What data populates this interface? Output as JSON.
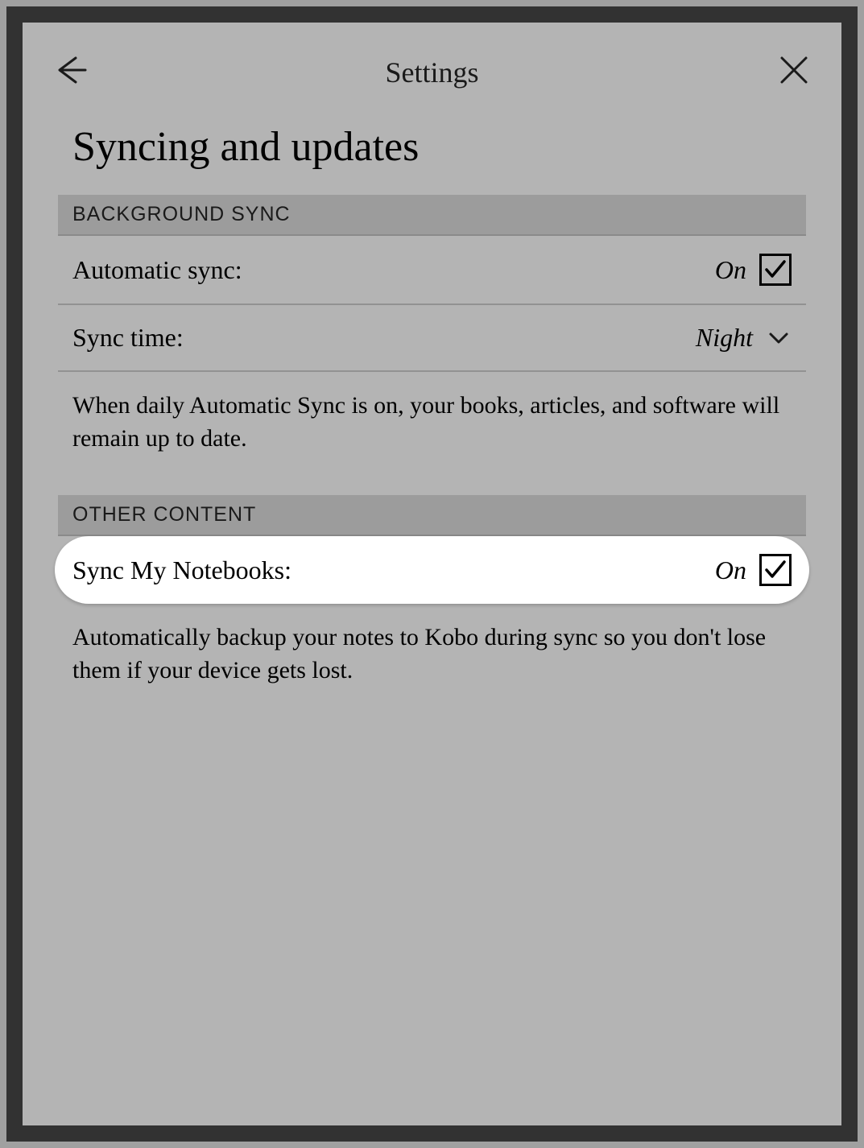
{
  "header": {
    "title": "Settings"
  },
  "page": {
    "title": "Syncing and updates"
  },
  "sections": {
    "backgroundSync": {
      "header": "BACKGROUND SYNC",
      "autoSync": {
        "label": "Automatic sync:",
        "value": "On"
      },
      "syncTime": {
        "label": "Sync time:",
        "value": "Night"
      },
      "description": "When daily Automatic Sync is on, your books, articles, and software will remain up to date."
    },
    "otherContent": {
      "header": "OTHER CONTENT",
      "syncNotebooks": {
        "label": "Sync My Notebooks:",
        "value": "On"
      },
      "description": "Automatically backup your notes to Kobo during sync so you don't lose them if your device gets lost."
    }
  }
}
